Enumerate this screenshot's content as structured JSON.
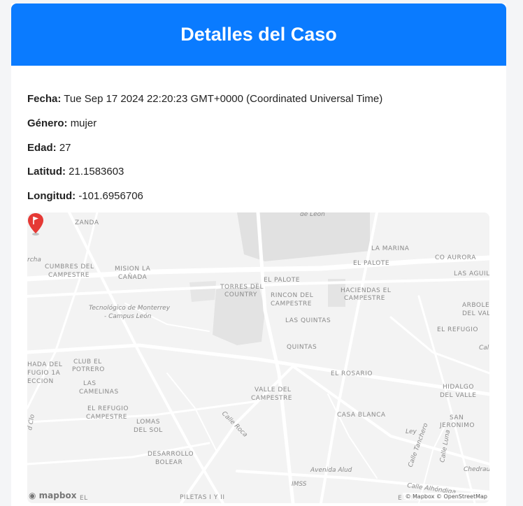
{
  "header": {
    "title": "Detalles del Caso"
  },
  "details": {
    "fecha_label": "Fecha:",
    "fecha_value": "Tue Sep 17 2024 22:20:23 GMT+0000 (Coordinated Universal Time)",
    "genero_label": "Género:",
    "genero_value": "mujer",
    "edad_label": "Edad:",
    "edad_value": "27",
    "latitud_label": "Latitud:",
    "latitud_value": "21.1583603",
    "longitud_label": "Longitud:",
    "longitud_value": "-101.6956706"
  },
  "map": {
    "logo": "mapbox",
    "attribution": "© Mapbox © OpenStreetMap",
    "labels": {
      "zanda": "ZANDA",
      "de_leon": "de León",
      "la_marina": "LA MARINA",
      "co_aurora": "CO AURORA",
      "el_palote_1": "EL PALOTE",
      "las_aguila": "LAS AGUILA",
      "cumbres_1": "CUMBRES DEL",
      "cumbres_2": "CAMPESTRE",
      "mision_1": "MISION LA",
      "mision_2": "CAÑADA",
      "el_palote_2": "EL PALOTE",
      "torres_1": "TORRES DEL",
      "torres_2": "COUNTRY",
      "rincon_1": "RINCON DEL",
      "rincon_2": "CAMPESTRE",
      "haciendas_1": "HACIENDAS EL",
      "haciendas_2": "CAMPESTRE",
      "arboledas_1": "ARBOLE",
      "arboledas_2": "DEL VAL",
      "tec_1": "Tecnológico de Monterrey",
      "tec_2": "- Campus León",
      "las_quintas": "LAS QUINTAS",
      "el_refugio_1": "EL REFUGIO",
      "quintas": "QUINTAS",
      "cal": "Cal",
      "hada_1": "HADA DEL",
      "hada_2": "FUGIO 1A",
      "hada_3": "ECCION",
      "club_1": "CLUB EL",
      "club_2": "POTRERO",
      "el_rosario": "EL ROSARIO",
      "camelinas_1": "LAS",
      "camelinas_2": "CAMELINAS",
      "valle_1": "VALLE DEL",
      "valle_2": "CAMPESTRE",
      "hidalgo_1": "HIDALGO",
      "hidalgo_2": "DEL VALLE",
      "refugio2_1": "EL REFUGIO",
      "refugio2_2": "CAMPESTRE",
      "calle_roca": "Calle Roca",
      "casa_blanca": "CASA BLANCA",
      "san_jer_1": "SAN",
      "san_jer_2": "JERONIMO",
      "lomas_1": "LOMAS",
      "lomas_2": "DEL SOL",
      "ley": "Ley",
      "tanchero": "Calle Tanchero",
      "calle_luna": "Calle Luna",
      "desarrollo_1": "DESARROLLO",
      "desarrollo_2": "BOLEAR",
      "avenida_alud": "Avenida Alud",
      "chedrau": "Chedrau",
      "imss": "IMSS",
      "calle_alhondiga": "Calle Alhóndiga",
      "el_bottom": "EL",
      "piletas": "PILETAS I Y II",
      "el_ro": "EL RO",
      "cerchа": "rcha",
      "clo": "d Clo"
    }
  }
}
